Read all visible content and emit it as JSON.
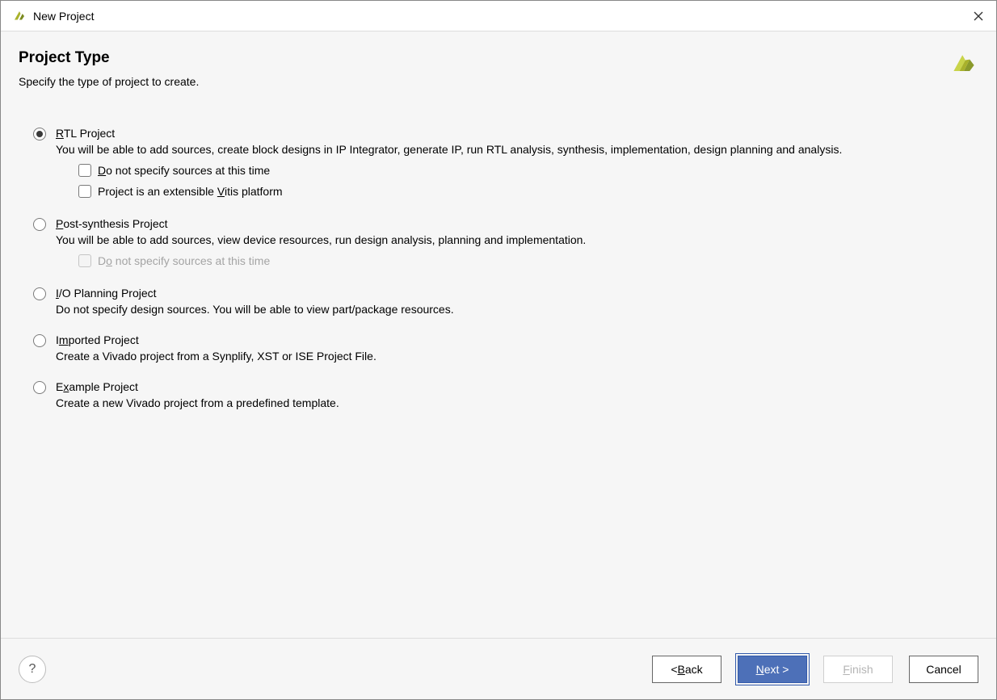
{
  "window": {
    "title": "New Project"
  },
  "header": {
    "title": "Project Type",
    "subtitle": "Specify the type of project to create."
  },
  "options": {
    "rtl": {
      "label_pre": "",
      "label_mn": "R",
      "label_post": "TL Project",
      "desc": "You will be able to add sources, create block designs in IP Integrator, generate IP, run RTL analysis, synthesis, implementation, design planning and analysis.",
      "cb1_pre": "",
      "cb1_mn": "D",
      "cb1_post": "o not specify sources at this time",
      "cb2_pre": "Project is an extensible ",
      "cb2_mn": "V",
      "cb2_post": "itis platform"
    },
    "post": {
      "label_pre": "",
      "label_mn": "P",
      "label_post": "ost-synthesis Project",
      "desc": "You will be able to add sources, view device resources, run design analysis, planning and implementation.",
      "cb1_pre": "D",
      "cb1_mn": "o",
      "cb1_post": " not specify sources at this time"
    },
    "io": {
      "label_pre": "",
      "label_mn": "I",
      "label_post": "/O Planning Project",
      "desc": "Do not specify design sources. You will be able to view part/package resources."
    },
    "imported": {
      "label_pre": "I",
      "label_mn": "m",
      "label_post": "ported Project",
      "desc": "Create a Vivado project from a Synplify, XST or ISE Project File."
    },
    "example": {
      "label_pre": "E",
      "label_mn": "x",
      "label_post": "ample Project",
      "desc": "Create a new Vivado project from a predefined template."
    }
  },
  "footer": {
    "help": "?",
    "back_pre": "< ",
    "back_mn": "B",
    "back_post": "ack",
    "next_pre": "",
    "next_mn": "N",
    "next_post": "ext >",
    "finish_pre": "",
    "finish_mn": "F",
    "finish_post": "inish",
    "cancel": "Cancel"
  }
}
